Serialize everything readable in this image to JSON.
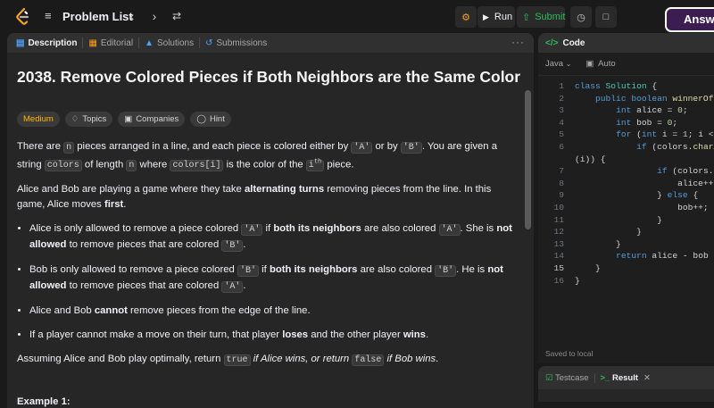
{
  "topbar": {
    "problem_list_label": "Problem List",
    "prev_icon": "chevron-left-icon",
    "next_icon": "chevron-right-icon",
    "shuffle_icon": "shuffle-icon",
    "run_label": "Run",
    "submit_label": "Submit",
    "answer_label": "Answer"
  },
  "left_tabs": [
    {
      "label": "Description",
      "icon": "description-icon",
      "active": true
    },
    {
      "label": "Editorial",
      "icon": "book-icon",
      "active": false
    },
    {
      "label": "Solutions",
      "icon": "flask-icon",
      "active": false
    },
    {
      "label": "Submissions",
      "icon": "history-icon",
      "active": false
    }
  ],
  "problem": {
    "title": "2038. Remove Colored Pieces if Both Neighbors are the Same Color",
    "difficulty": "Medium",
    "chips": [
      "Topics",
      "Companies",
      "Hint"
    ],
    "p1": {
      "t1": "There are ",
      "c1": "n",
      "t2": " pieces arranged in a line, and each piece is colored either by ",
      "c2": "'A'",
      "t3": " or by ",
      "c3": "'B'",
      "t4": ". You are given a string ",
      "c4": "colors",
      "t5": " of length ",
      "c5": "n",
      "t6": " where ",
      "c6": "colors[i]",
      "t7": " is the color of the ",
      "t8": "i",
      "sup": "th",
      "t9": " piece."
    },
    "p2": {
      "t1": "Alice and Bob are playing a game where they take ",
      "b1": "alternating turns",
      "t2": " removing pieces from the line. In this game, Alice moves ",
      "b2": "first",
      "t3": "."
    },
    "bullets": {
      "b1": {
        "t1": "Alice is only allowed to remove a piece colored ",
        "c1": "'A'",
        "t2": " if ",
        "s1": "both its neighbors",
        "t3": " are also colored ",
        "c2": "'A'",
        "t4": ". She is ",
        "s2": "not allowed",
        "t5": " to remove pieces that are colored ",
        "c3": "'B'",
        "t6": "."
      },
      "b2": {
        "t1": "Bob is only allowed to remove a piece colored ",
        "c1": "'B'",
        "t2": " if ",
        "s1": "both its neighbors",
        "t3": " are also colored ",
        "c2": "'B'",
        "t4": ". He is ",
        "s2": "not allowed",
        "t5": " to remove pieces that are colored ",
        "c3": "'A'",
        "t6": "."
      },
      "b3": {
        "t1": "Alice and Bob ",
        "s1": "cannot",
        "t2": " remove pieces from the edge of the line."
      },
      "b4": {
        "t1": "If a player cannot make a move on their turn, that player ",
        "s1": "loses",
        "t2": " and the other player ",
        "s2": "wins",
        "t3": "."
      }
    },
    "p3": {
      "t1": "Assuming Alice and Bob play optimally, return ",
      "c1": "true",
      "i1": " if Alice wins, or return ",
      "c2": "false",
      "i2": " if Bob wins",
      "t2": "."
    },
    "example_title": "Example 1:"
  },
  "code_panel": {
    "title": "Code",
    "language": "Java",
    "mode": "Auto",
    "saved_text": "Saved to local",
    "current_line": 15
  },
  "code_lines": [
    {
      "n": "1",
      "tokens": [
        [
          "kw",
          "class "
        ],
        [
          "cls",
          "Solution "
        ],
        [
          "pn",
          "{"
        ]
      ]
    },
    {
      "n": "2",
      "tokens": [
        [
          "pn",
          "    "
        ],
        [
          "kw",
          "public boolean "
        ],
        [
          "fn",
          "winnerOfGa"
        ]
      ]
    },
    {
      "n": "3",
      "tokens": [
        [
          "pn",
          "        "
        ],
        [
          "kw",
          "int "
        ],
        [
          "pn",
          "alice = "
        ],
        [
          "num",
          "0"
        ],
        [
          "pn",
          ";"
        ]
      ]
    },
    {
      "n": "4",
      "tokens": [
        [
          "pn",
          "        "
        ],
        [
          "kw",
          "int "
        ],
        [
          "pn",
          "bob = "
        ],
        [
          "num",
          "0"
        ],
        [
          "pn",
          ";"
        ]
      ]
    },
    {
      "n": "5",
      "tokens": [
        [
          "pn",
          "        "
        ],
        [
          "kw",
          "for "
        ],
        [
          "pn",
          "("
        ],
        [
          "kw",
          "int "
        ],
        [
          "pn",
          "i = "
        ],
        [
          "num",
          "1"
        ],
        [
          "pn",
          "; i < c"
        ]
      ]
    },
    {
      "n": "6",
      "tokens": [
        [
          "pn",
          "            "
        ],
        [
          "kw",
          "if "
        ],
        [
          "pn",
          "(colors."
        ],
        [
          "fn",
          "charAt"
        ]
      ]
    },
    {
      "n": "",
      "tokens": [
        [
          "pn",
          "(i)) {"
        ]
      ]
    },
    {
      "n": "7",
      "tokens": [
        [
          "pn",
          "                "
        ],
        [
          "kw",
          "if "
        ],
        [
          "pn",
          "(colors.ch"
        ]
      ]
    },
    {
      "n": "8",
      "tokens": [
        [
          "pn",
          "                    alice++;"
        ]
      ]
    },
    {
      "n": "9",
      "tokens": [
        [
          "pn",
          "                } "
        ],
        [
          "kw",
          "else "
        ],
        [
          "pn",
          "{"
        ]
      ]
    },
    {
      "n": "10",
      "tokens": [
        [
          "pn",
          "                    bob++;"
        ]
      ]
    },
    {
      "n": "11",
      "tokens": [
        [
          "pn",
          "                }"
        ]
      ]
    },
    {
      "n": "12",
      "tokens": [
        [
          "pn",
          "            }"
        ]
      ]
    },
    {
      "n": "13",
      "tokens": [
        [
          "pn",
          "        }"
        ]
      ]
    },
    {
      "n": "14",
      "tokens": [
        [
          "pn",
          "        "
        ],
        [
          "kw",
          "return "
        ],
        [
          "pn",
          "alice - bob >"
        ]
      ]
    },
    {
      "n": "15",
      "tokens": [
        [
          "pn",
          "    }"
        ]
      ]
    },
    {
      "n": "16",
      "tokens": [
        [
          "pn",
          "}"
        ]
      ]
    }
  ],
  "bottom_tabs": [
    {
      "label": "Testcase",
      "icon": "checkbox-icon",
      "active": false
    },
    {
      "label": "Result",
      "icon": "terminal-icon",
      "active": true
    }
  ],
  "colors": {
    "accent_green": "#2cbb5d",
    "difficulty_medium": "#ffb800",
    "answer_bg": "#3b1d52"
  }
}
